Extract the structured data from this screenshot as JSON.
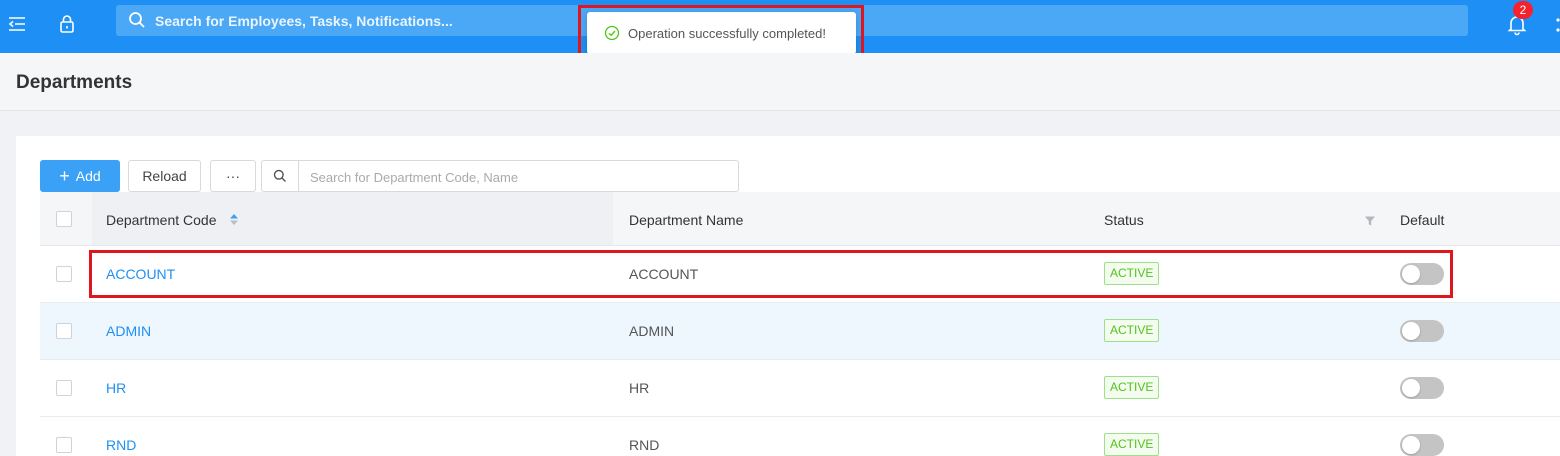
{
  "header": {
    "search_placeholder": "Search for Employees, Tasks, Notifications...",
    "notification_count": "2"
  },
  "toast": {
    "message": "Operation successfully completed!"
  },
  "page": {
    "title": "Departments"
  },
  "toolbar": {
    "add_label": "Add",
    "add_plus": "+",
    "reload_label": "Reload",
    "more_label": "···",
    "search_placeholder": "Search for Department Code, Name"
  },
  "table": {
    "columns": {
      "code": "Department Code",
      "name": "Department Name",
      "status": "Status",
      "default": "Default"
    },
    "rows": [
      {
        "code": "ACCOUNT",
        "name": "ACCOUNT",
        "status": "ACTIVE",
        "default": false
      },
      {
        "code": "ADMIN",
        "name": "ADMIN",
        "status": "ACTIVE",
        "default": false
      },
      {
        "code": "HR",
        "name": "HR",
        "status": "ACTIVE",
        "default": false
      },
      {
        "code": "RND",
        "name": "RND",
        "status": "ACTIVE",
        "default": false
      }
    ]
  },
  "colors": {
    "brand": "#1e90f5",
    "success": "#52c41a",
    "highlight": "#e0161e"
  },
  "icons": [
    "menu-icon",
    "lock-icon",
    "search-icon",
    "bell-icon",
    "check-circle-icon",
    "sort-icon",
    "filter-icon"
  ]
}
